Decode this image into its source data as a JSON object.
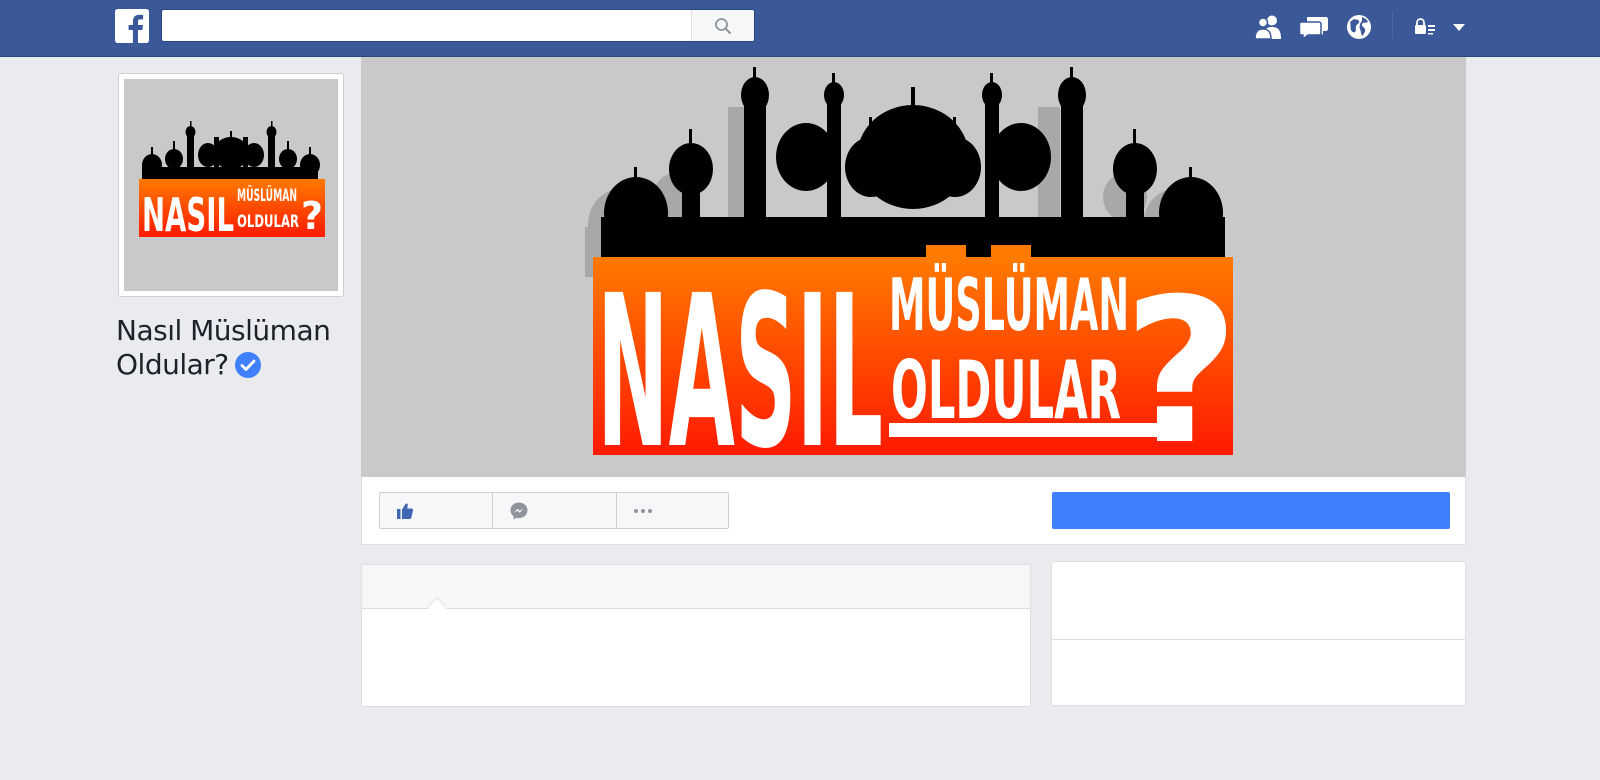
{
  "app": {
    "brand": "facebook",
    "brand_color": "#3b5998",
    "background_color": "#e9ebee"
  },
  "header": {
    "logo_icon": "facebook-f-icon",
    "search": {
      "placeholder": "",
      "value": "",
      "icon": "magnifier-icon"
    },
    "icons": [
      "friend-requests-icon",
      "messages-icon",
      "notifications-globe-icon",
      "privacy-lock-icon",
      "caret-down-icon"
    ]
  },
  "page": {
    "name_line1": "Nasıl Müslüman",
    "name_line2": "Oldular?",
    "verified": true,
    "verified_color": "#4080ff",
    "logo_text": {
      "big": "NASIL",
      "top": "MÜSLÜMAN",
      "bottom": "OLDULAR",
      "mark": "?"
    },
    "logo_colors": {
      "top": "#ff7a00",
      "bottom": "#ff1a00",
      "silhouette": "#000000"
    }
  },
  "actions": {
    "buttons": [
      {
        "id": "like",
        "icon": "thumbs-up-icon",
        "label": ""
      },
      {
        "id": "message",
        "icon": "messenger-icon",
        "label": ""
      },
      {
        "id": "more",
        "icon": "more-dots-icon",
        "label": ""
      }
    ],
    "cta_label": "",
    "cta_color": "#4080ff"
  }
}
